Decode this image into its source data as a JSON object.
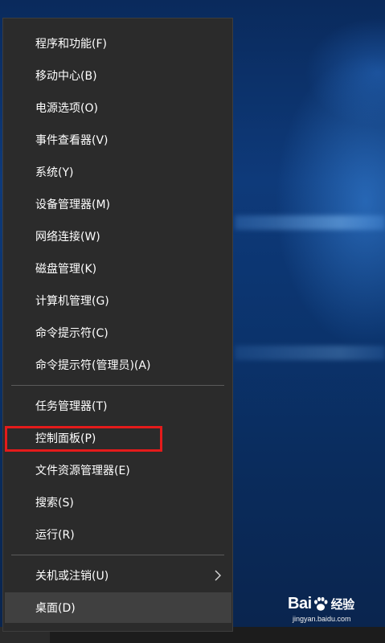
{
  "menu": {
    "items": [
      {
        "label": "程序和功能(F)"
      },
      {
        "label": "移动中心(B)"
      },
      {
        "label": "电源选项(O)"
      },
      {
        "label": "事件查看器(V)"
      },
      {
        "label": "系统(Y)"
      },
      {
        "label": "设备管理器(M)"
      },
      {
        "label": "网络连接(W)"
      },
      {
        "label": "磁盘管理(K)"
      },
      {
        "label": "计算机管理(G)"
      },
      {
        "label": "命令提示符(C)"
      },
      {
        "label": "命令提示符(管理员)(A)"
      },
      {
        "label": "任务管理器(T)"
      },
      {
        "label": "控制面板(P)"
      },
      {
        "label": "文件资源管理器(E)"
      },
      {
        "label": "搜索(S)"
      },
      {
        "label": "运行(R)"
      },
      {
        "label": "关机或注销(U)",
        "icon": "chevron-right-icon"
      },
      {
        "label": "桌面(D)",
        "state": "hovered"
      }
    ],
    "highlighted_item": "控制面板(P)",
    "highlight_color": "#e41b1b"
  },
  "watermark": {
    "brand": "Bai",
    "brand_suffix": "经验",
    "icon": "paw-icon",
    "url": "jingyan.baidu.com"
  },
  "colors": {
    "menu_background": "#2b2b2b",
    "menu_text": "#ffffff",
    "hover_background": "#404040",
    "separator": "#5a5a5a"
  }
}
